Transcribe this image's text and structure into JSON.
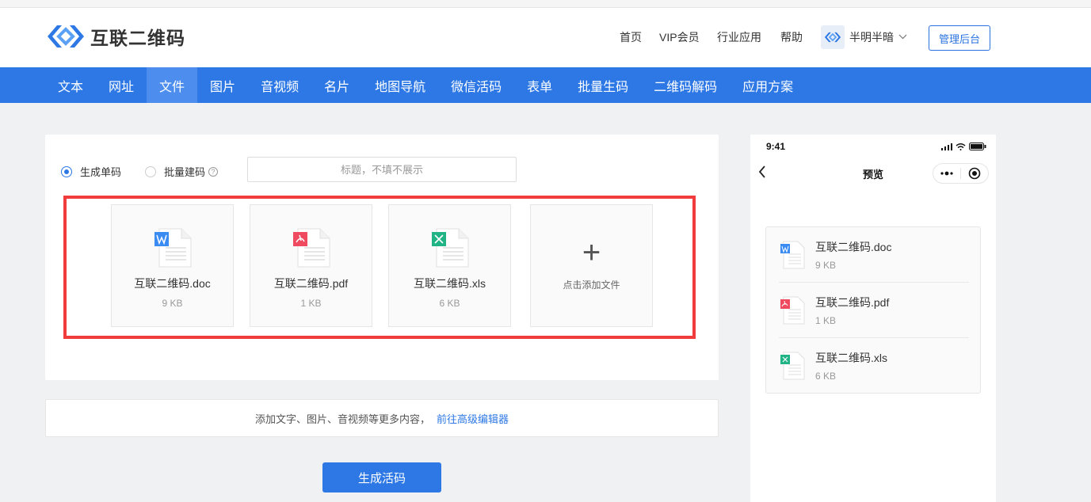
{
  "header": {
    "logo_text": "互联二维码",
    "nav": [
      "首页",
      "VIP会员",
      "行业应用",
      "帮助"
    ],
    "username": "半明半暗",
    "admin_label": "管理后台"
  },
  "tabs": [
    {
      "label": "文本"
    },
    {
      "label": "网址"
    },
    {
      "label": "文件"
    },
    {
      "label": "图片"
    },
    {
      "label": "音视频"
    },
    {
      "label": "名片"
    },
    {
      "label": "地图导航"
    },
    {
      "label": "微信活码"
    },
    {
      "label": "表单"
    },
    {
      "label": "批量生码"
    },
    {
      "label": "二维码解码"
    },
    {
      "label": "应用方案"
    }
  ],
  "active_tab": "文件",
  "form": {
    "mode_single": "生成单码",
    "mode_batch": "批量建码",
    "title_placeholder": "标题，不填不展示",
    "files": [
      {
        "name": "互联二维码.doc",
        "size": "9 KB",
        "type": "doc",
        "icon": "word-file-icon"
      },
      {
        "name": "互联二维码.pdf",
        "size": "1 KB",
        "type": "pdf",
        "icon": "pdf-file-icon"
      },
      {
        "name": "互联二维码.xls",
        "size": "6 KB",
        "type": "xls",
        "icon": "excel-file-icon"
      }
    ],
    "add_file_label": "点击添加文件",
    "more_text": "添加文字、图片、音视频等更多内容，",
    "more_link": "前往高级编辑器",
    "generate_label": "生成活码"
  },
  "preview": {
    "time": "9:41",
    "title": "预览",
    "files": [
      {
        "name": "互联二维码.doc",
        "size": "9 KB"
      },
      {
        "name": "互联二维码.pdf",
        "size": "1 KB"
      },
      {
        "name": "互联二维码.xls",
        "size": "6 KB"
      }
    ]
  },
  "colors": {
    "brand": "#2d78e5",
    "highlight": "#f03c3c",
    "doc": "#3b8cf2",
    "pdf": "#ef4a5f",
    "xls": "#1fb386"
  }
}
